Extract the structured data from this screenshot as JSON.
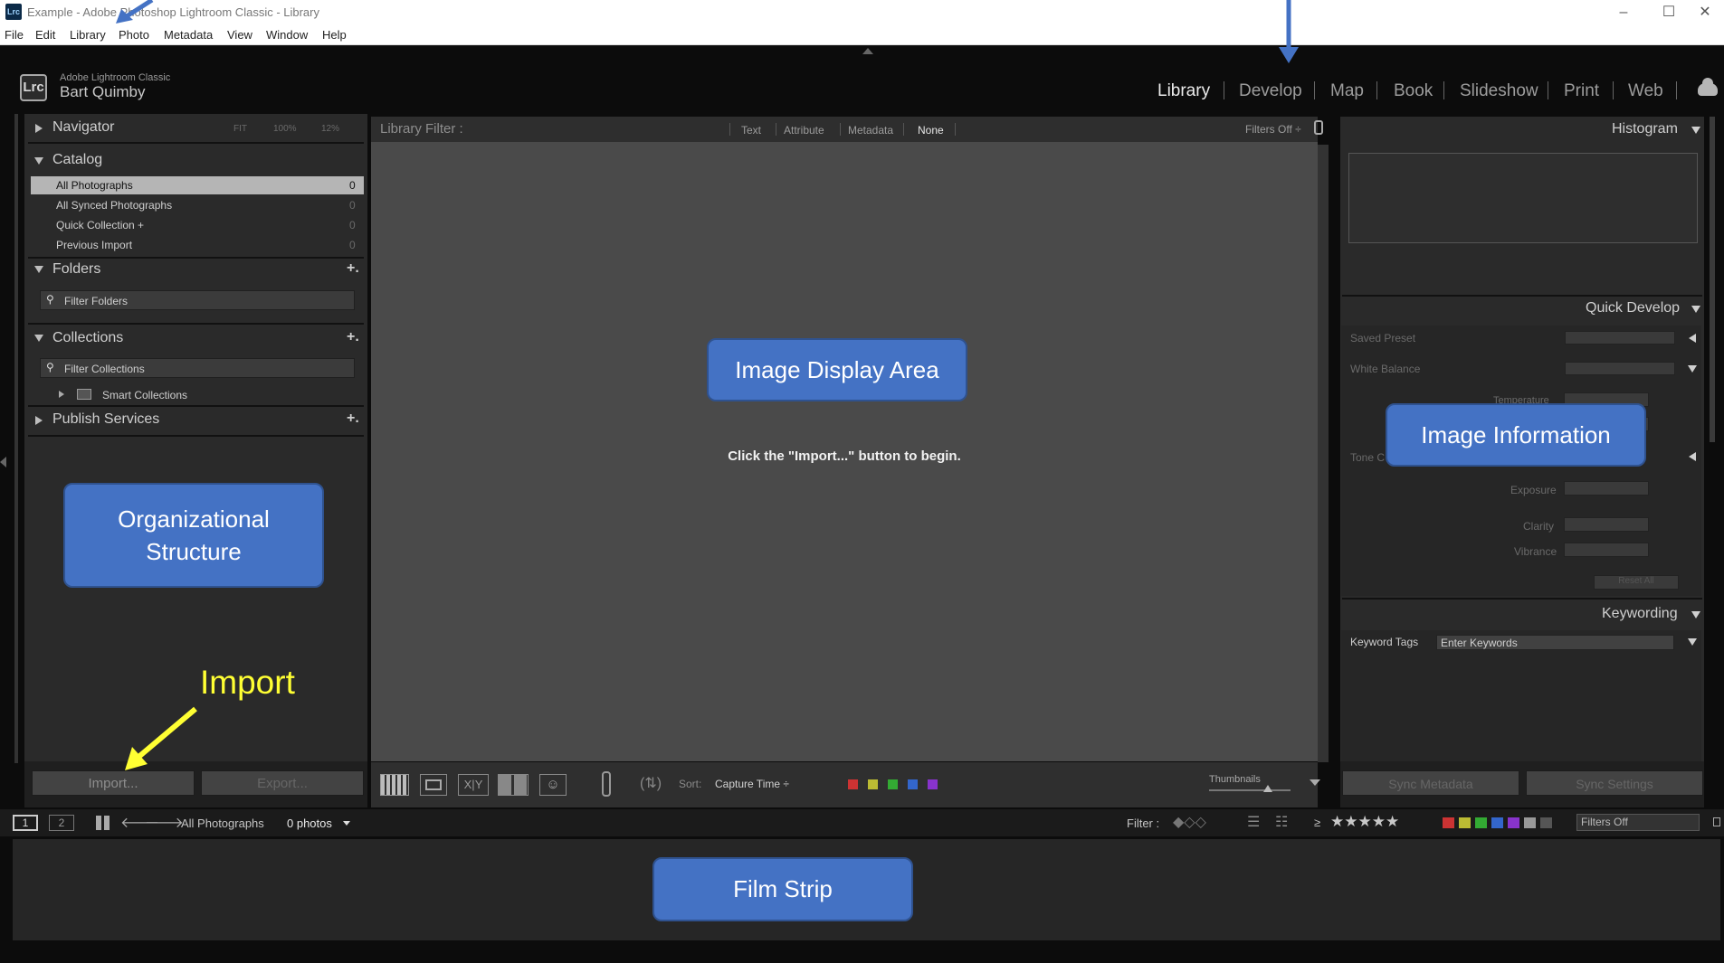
{
  "window": {
    "title": "Example - Adobe Photoshop Lightroom Classic - Library"
  },
  "menu": [
    "File",
    "Edit",
    "Library",
    "Photo",
    "Metadata",
    "View",
    "Window",
    "Help"
  ],
  "identity": {
    "logo_text": "Lrc",
    "brand": "Adobe Lightroom Classic",
    "user": "Bart Quimby"
  },
  "modules": [
    "Library",
    "Develop",
    "Map",
    "Book",
    "Slideshow",
    "Print",
    "Web"
  ],
  "left_panel": {
    "navigator": {
      "title": "Navigator",
      "zoom_options": [
        "FIT",
        "100%",
        "12%"
      ]
    },
    "catalog": {
      "title": "Catalog",
      "items": [
        {
          "label": "All Photographs",
          "count": "0"
        },
        {
          "label": "All Synced Photographs",
          "count": "0"
        },
        {
          "label": "Quick Collection +",
          "count": "0"
        },
        {
          "label": "Previous Import",
          "count": "0"
        }
      ]
    },
    "folders": {
      "title": "Folders",
      "plus": "+.",
      "filter_placeholder": "Filter Folders"
    },
    "collections": {
      "title": "Collections",
      "plus": "+.",
      "filter_placeholder": "Filter Collections",
      "smart_collections": "Smart Collections"
    },
    "publish": {
      "title": "Publish Services",
      "plus": "+."
    },
    "import_label": "Import...",
    "export_label": "Export..."
  },
  "library_filter": {
    "label": "Library Filter :",
    "options": [
      "Text",
      "Attribute",
      "Metadata",
      "None"
    ],
    "filters_off": "Filters Off ÷"
  },
  "center": {
    "message": "Click the \"Import...\" button to begin."
  },
  "toolbar": {
    "sort_label": "Sort:",
    "sort_value": "Capture Time ÷",
    "thumbnails_label": "Thumbnails",
    "color_labels": [
      "#c33",
      "#bb3",
      "#3a3",
      "#36c",
      "#83c"
    ]
  },
  "right_panel": {
    "histogram": "Histogram",
    "quick_develop": {
      "title": "Quick Develop",
      "saved_preset": "Saved Preset",
      "white_balance": "White Balance",
      "temperature": "Temperature",
      "tone_control": "Tone C",
      "exposure": "Exposure",
      "clarity": "Clarity",
      "vibrance": "Vibrance",
      "reset": "Reset All"
    },
    "keywording": {
      "title": "Keywording",
      "keyword_tags": "Keyword Tags",
      "enter_keywords": "Enter Keywords"
    },
    "sync_metadata": "Sync Metadata",
    "sync_settings": "Sync Settings"
  },
  "filmstrip_bar": {
    "monitor1": "1",
    "monitor2": "2",
    "source": "All Photographs",
    "count": "0 photos",
    "filter_label": "Filter :",
    "ge_symbol": "≥",
    "stars": "★★★★★",
    "filters_off": "Filters Off"
  },
  "callouts": {
    "display_area": "Image Display Area",
    "organizational": "Organizational Structure",
    "import": "Import",
    "image_info": "Image Information",
    "film_strip": "Film Strip"
  },
  "colors": {
    "callout_fill": "#4472c4",
    "callout_arrow": "#ffff33",
    "pointer_arrow": "#4472c4"
  }
}
